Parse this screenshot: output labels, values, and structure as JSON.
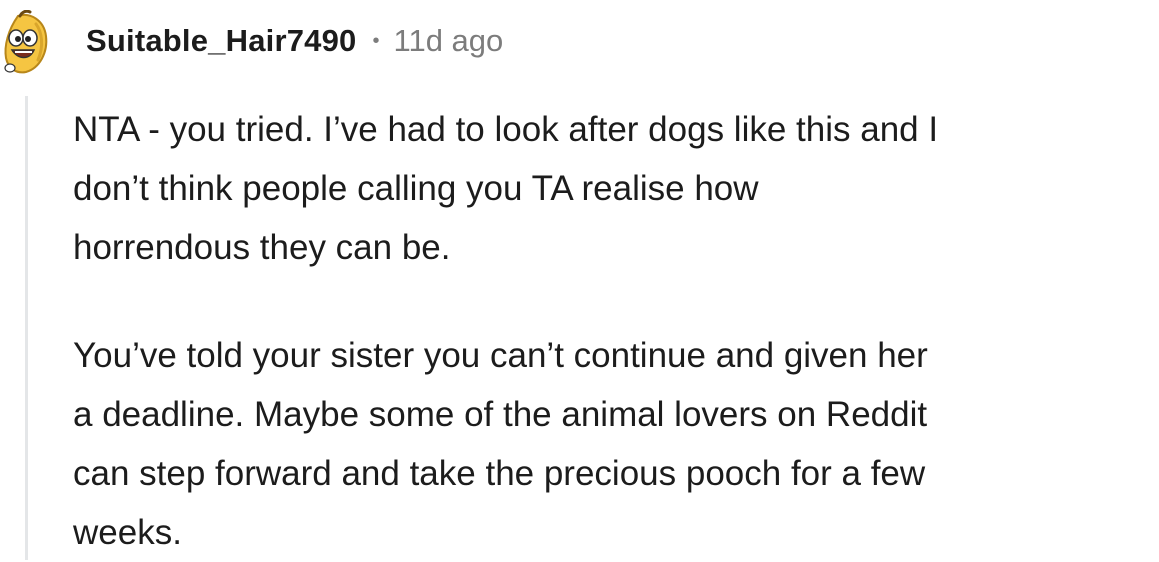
{
  "comment": {
    "username": "Suitable_Hair7490",
    "separator": "•",
    "timestamp": "11d ago",
    "avatar_icon": "snoo-banana-avatar-icon",
    "paragraphs": [
      "NTA - you tried. I’ve had to look after dogs like this and I\ndon’t think people calling you TA realise how\nhorrendous they can be.",
      "You’ve told your sister you can’t continue and given her\na deadline. Maybe some of the animal lovers on Reddit\ncan step forward and take the precious pooch for a few\nweeks."
    ]
  },
  "colors": {
    "text": "#1c1c1c",
    "meta": "#7c7c7c",
    "thread_line": "#e4e6e8",
    "avatar_yellow": "#f5c542"
  }
}
